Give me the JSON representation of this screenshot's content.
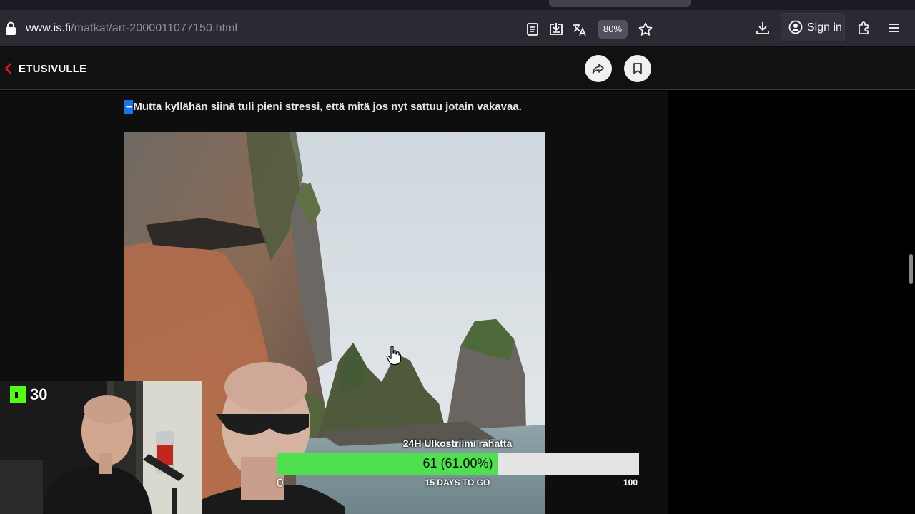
{
  "browser": {
    "url_host": "www.is.fi",
    "url_path": "/matkat/art-2000011077150.html",
    "zoom": "80%",
    "sign_in_label": "Sign in",
    "icons": [
      "lock-icon",
      "reader-view-icon",
      "save-page-icon",
      "translate-icon",
      "bookmark-star-icon",
      "download-icon",
      "account-icon",
      "extensions-icon",
      "menu-icon"
    ]
  },
  "site_header": {
    "back_label": "ETUSIVULLE",
    "accent_color": "#e8112d",
    "icons": [
      "chevron-left-icon",
      "share-icon",
      "bookmark-icon"
    ]
  },
  "article": {
    "quote_dash": "–",
    "quote_text": "Mutta kyllähän siinä tuli pieni stressi, että mitä jos nyt sattuu jotain vakavaa.",
    "image_subject": "limestone karst cliffs rising from the sea under a pale sky"
  },
  "stream": {
    "viewer_count": "30",
    "platform_icon": "kick-logo-icon",
    "goal": {
      "title": "24H Ulkostriimi rahatta",
      "value_text": "61 (61.00%)",
      "progress": 0.61,
      "min": "0",
      "max": "100",
      "days_left": "15 DAYS TO GO",
      "fill_color": "#4fe04f"
    }
  }
}
